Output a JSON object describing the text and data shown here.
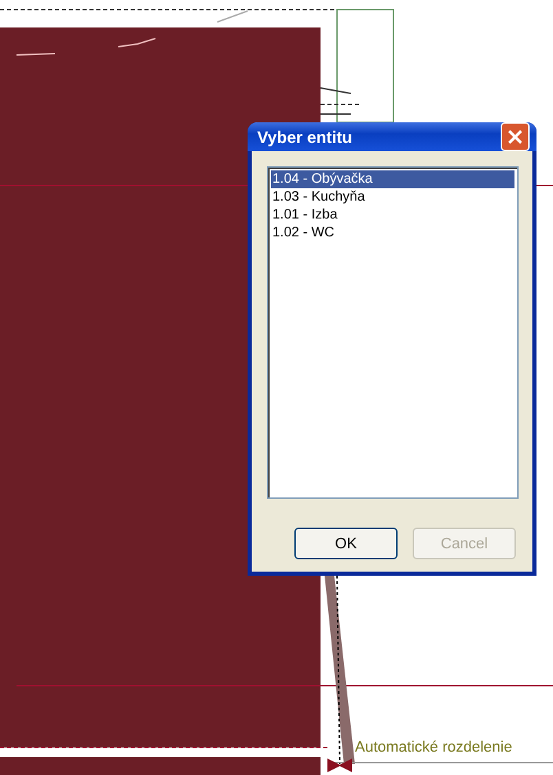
{
  "dialog": {
    "title": "Vyber entitu",
    "close": "×",
    "items": [
      {
        "label": "1.04 - Obývačka",
        "selected": true
      },
      {
        "label": "1.03 - Kuchyňa",
        "selected": false
      },
      {
        "label": "1.01 - Izba",
        "selected": false
      },
      {
        "label": "1.02 - WC",
        "selected": false
      }
    ],
    "buttons": [
      {
        "label": "OK",
        "disabled": false
      },
      {
        "label": "Cancel",
        "disabled": true
      }
    ]
  },
  "canvas": {
    "annotation": "Automatické rozdelenie"
  }
}
